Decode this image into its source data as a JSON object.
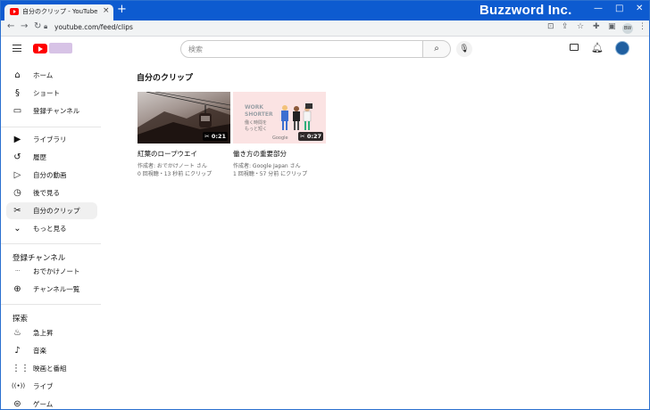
{
  "browser": {
    "tab_title": "自分のクリップ - YouTube",
    "tab_close": "×",
    "new_tab": "+",
    "brand": "Buzzword Inc.",
    "window_controls": [
      "—",
      "□",
      "✕"
    ],
    "url": "youtube.com/feed/clips",
    "profile_initials": "BW"
  },
  "header": {
    "search_placeholder": "検索"
  },
  "sidebar": {
    "main_items": [
      {
        "label": "ホーム",
        "icon": "home-icon"
      },
      {
        "label": "ショート",
        "icon": "shorts-icon"
      },
      {
        "label": "登録チャンネル",
        "icon": "subscriptions-icon"
      }
    ],
    "library_items": [
      {
        "label": "ライブラリ",
        "icon": "library-icon"
      },
      {
        "label": "履歴",
        "icon": "history-icon"
      },
      {
        "label": "自分の動画",
        "icon": "your-videos-icon"
      },
      {
        "label": "後で見る",
        "icon": "watch-later-icon"
      },
      {
        "label": "自分のクリップ",
        "icon": "scissors-icon",
        "active": true
      },
      {
        "label": "もっと見る",
        "icon": "chevron-down-icon"
      }
    ],
    "subscriptions_heading": "登録チャンネル",
    "subscription_items": [
      {
        "label": "おでかけノート",
        "icon": "channel-avatar-icon"
      },
      {
        "label": "チャンネル一覧",
        "icon": "add-circle-icon"
      }
    ],
    "explore_heading": "探索",
    "explore_items": [
      {
        "label": "急上昇",
        "icon": "trending-icon"
      },
      {
        "label": "音楽",
        "icon": "music-icon"
      },
      {
        "label": "映画と番組",
        "icon": "film-icon"
      },
      {
        "label": "ライブ",
        "icon": "live-icon"
      },
      {
        "label": "ゲーム",
        "icon": "gaming-icon"
      }
    ]
  },
  "main": {
    "title": "自分のクリップ",
    "clips": [
      {
        "title": "紅葉のロープウエイ",
        "author": "作成者: おでかけノート さん",
        "stats": "0 回視聴・13 秒前 にクリップ",
        "duration": "0:21"
      },
      {
        "title": "働き方の重要部分",
        "author": "作成者: Google Japan さん",
        "stats": "1 回視聴・57 分前 にクリップ",
        "duration": "0:27",
        "thumb_line1": "WORK",
        "thumb_line2": "SHORTER",
        "thumb_line3": "働く時間を",
        "thumb_line4": "もっと短く",
        "thumb_footer": "Google"
      }
    ]
  }
}
